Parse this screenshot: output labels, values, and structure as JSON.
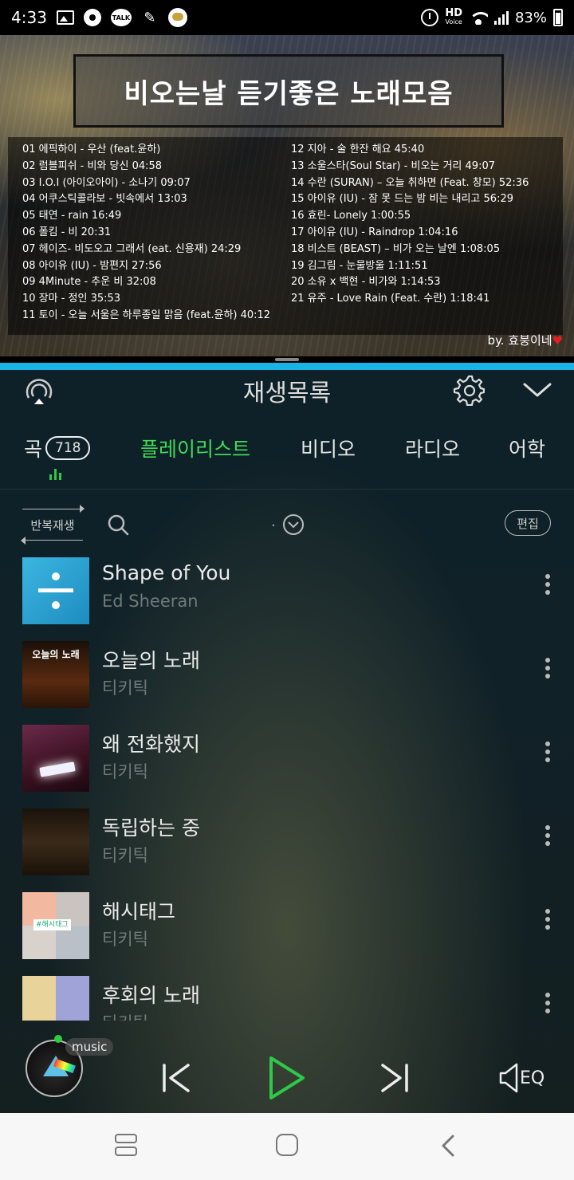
{
  "status_bar": {
    "time": "4:33",
    "hd": "HD",
    "hd_sub": "Voice",
    "battery": "83%",
    "talk": "TALK"
  },
  "video": {
    "title": "비오는날 듣기좋은 노래모음",
    "credit": "by. 효붕이네",
    "heart": "♥",
    "tracks_left": [
      "01 에픽하이 - 우산 (feat.윤하)",
      "02 럼블피쉬 - 비와 당신 04:58",
      "03 I.O.I (아이오아이) - 소나기 09:07",
      "04 어쿠스틱콜라보 - 빗속에서 13:03",
      "05 태연 - rain 16:49",
      "06 폴킴 - 비 20:31",
      "07 헤이즈- 비도오고 그래서 (eat. 신용재) 24:29",
      "08 아이유 (IU) - 밤편지 27:56",
      "09 4Minute - 추운 비 32:08",
      "10 장마 -  정인 35:53",
      "11 토이 - 오늘 서울은 하루종일 맑음 (feat.윤하) 40:12"
    ],
    "tracks_right": [
      "12 지아 - 술 한잔 해요 45:40",
      "13 소울스타(Soul Star) - 비오는 거리 49:07",
      "14 수란 (SURAN) – 오늘 취하면 (Feat. 창모) 52:36",
      "15 아이유 (IU) - 잠 못 드는 밤 비는 내리고 56:29",
      "16 효린- Lonely 1:00:55",
      "17 아이유 (IU) - Raindrop 1:04:16",
      "18 비스트 (BEAST) – 비가 오는 날엔 1:08:05",
      "19 김그림 - 눈물방울 1:11:51",
      "20 소유 x 백현 - 비가와 1:14:53",
      "21 유주 - Love Rain (Feat. 수란) 1:18:41"
    ]
  },
  "header": {
    "title": "재생목록"
  },
  "tabs": {
    "song": "곡",
    "song_count": "718",
    "playlist": "플레이리스트",
    "video": "비디오",
    "radio": "라디오",
    "language": "어학"
  },
  "tools": {
    "repeat": "반복재생",
    "sort_dot": ".",
    "edit": "편집"
  },
  "songs": [
    {
      "title": "Shape of You",
      "artist": "Ed Sheeran",
      "thumb_label": ""
    },
    {
      "title": "오늘의 노래",
      "artist": "티키틱",
      "thumb_label": "오늘의 노래"
    },
    {
      "title": "왜 전화했지",
      "artist": "티키틱",
      "thumb_label": ""
    },
    {
      "title": "독립하는 중",
      "artist": "티키틱",
      "thumb_label": ""
    },
    {
      "title": "해시태그",
      "artist": "티키틱",
      "thumb_label": "#해시태그"
    },
    {
      "title": "후회의 노래",
      "artist": "티키틱",
      "thumb_label": ""
    }
  ],
  "mini_player": {
    "badge": "music",
    "eq": "EQ"
  },
  "colors": {
    "accent_green": "#3ddc56",
    "divider_blue": "#1ab3e6"
  }
}
